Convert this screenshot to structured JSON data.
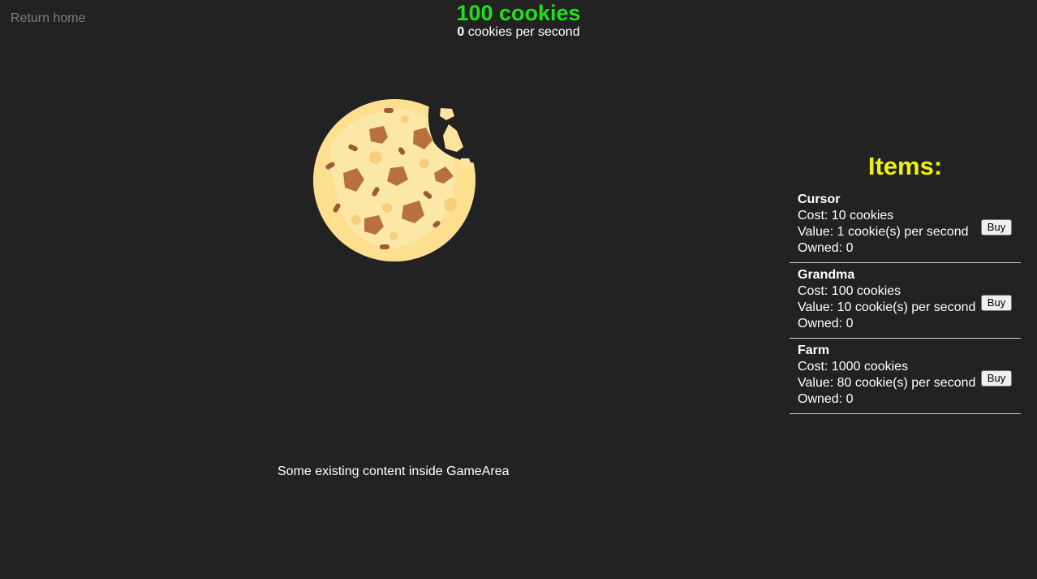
{
  "nav": {
    "return_home": "Return home"
  },
  "header": {
    "cookie_count": "100 cookies",
    "cps_value": "0",
    "cps_label": " cookies per second"
  },
  "cookie": {
    "icon": "cookie-icon"
  },
  "game_area": {
    "text": "Some existing content inside GameArea"
  },
  "shop": {
    "title": "Items:",
    "items": [
      {
        "name": "Cursor",
        "cost": "Cost: 10 cookies",
        "value": "Value: 1 cookie(s) per second",
        "owned": "Owned: 0",
        "buy_label": "Buy"
      },
      {
        "name": "Grandma",
        "cost": "Cost: 100 cookies",
        "value": "Value: 10 cookie(s) per second",
        "owned": "Owned: 0",
        "buy_label": "Buy"
      },
      {
        "name": "Farm",
        "cost": "Cost: 1000 cookies",
        "value": "Value: 80 cookie(s) per second",
        "owned": "Owned: 0",
        "buy_label": "Buy"
      }
    ]
  },
  "colors": {
    "background": "#222222",
    "cookie_count": "#1fe01f",
    "shop_title": "#f2f20a",
    "return_home": "#7d7d7d"
  }
}
